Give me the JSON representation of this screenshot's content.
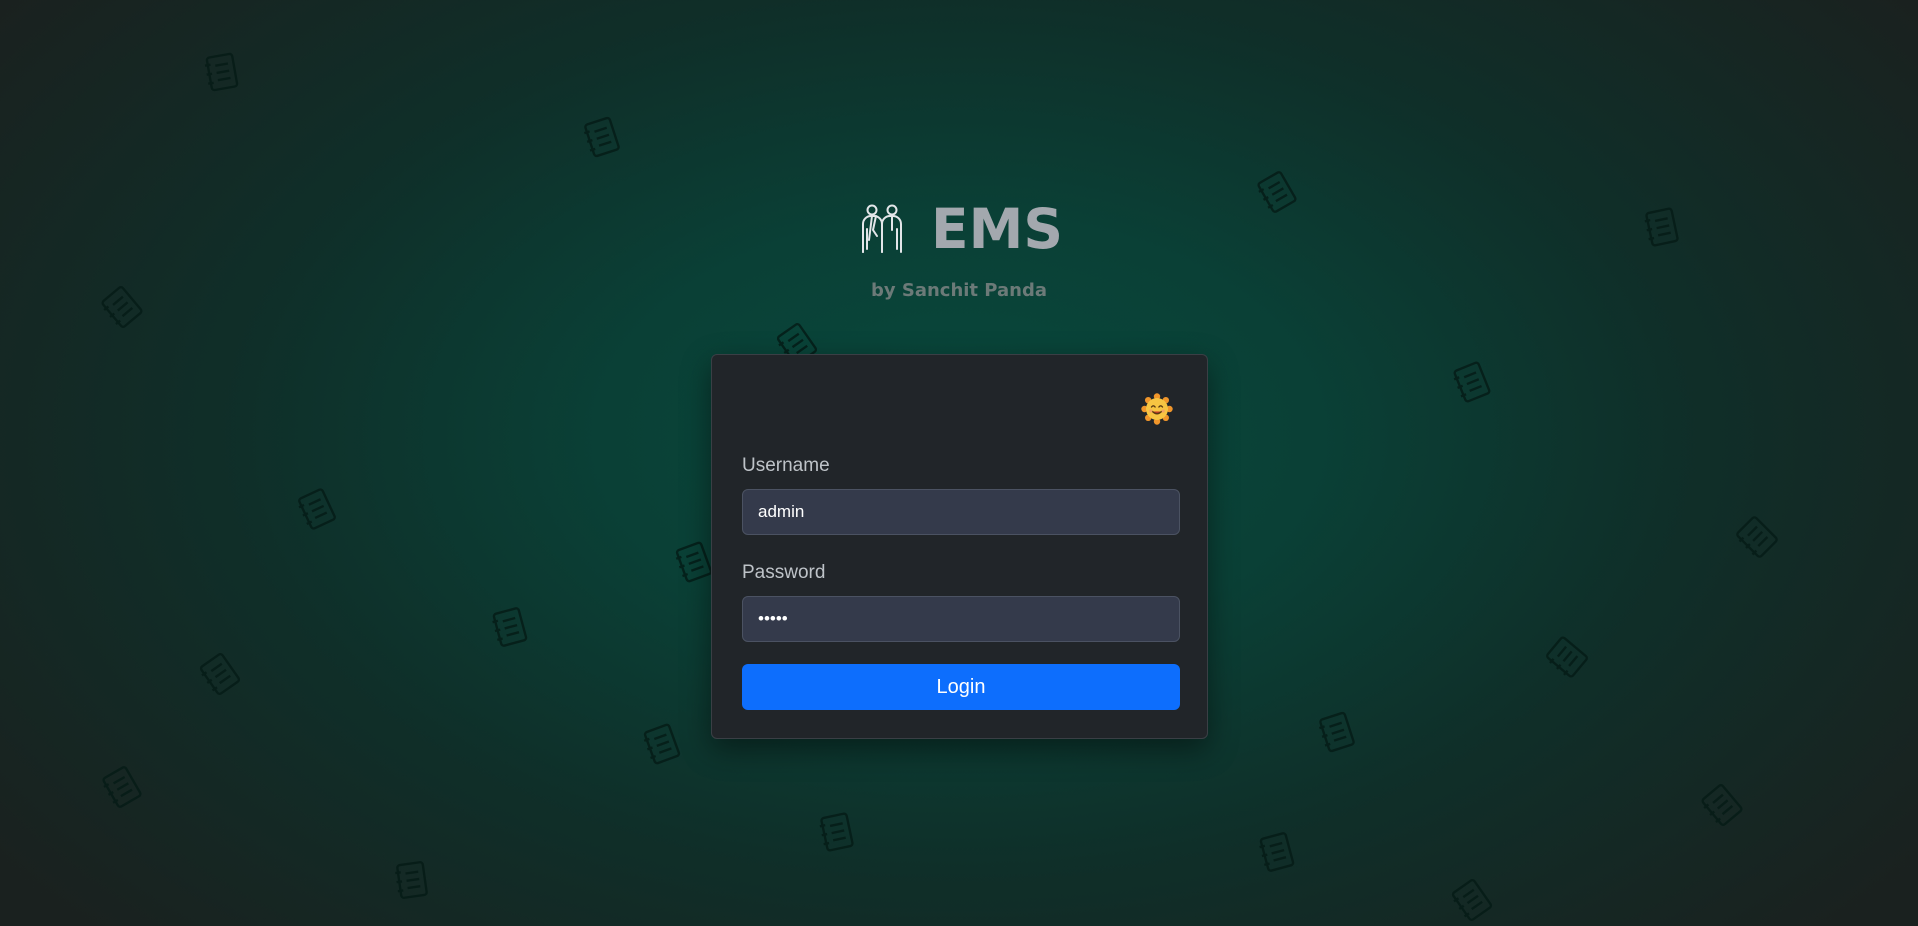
{
  "app": {
    "title": "EMS",
    "subtitle": "by Sanchit Panda",
    "logo_icon": "employees-icon",
    "background_icon": "notebook-icon"
  },
  "theme_toggle": {
    "icon": "smiling-sun-icon"
  },
  "form": {
    "username": {
      "label": "Username",
      "value": "admin"
    },
    "password": {
      "label": "Password",
      "value": "admin"
    },
    "submit_label": "Login"
  },
  "colors": {
    "accent": "#0d6efd",
    "card_bg": "#212529",
    "input_bg": "#343a4b",
    "bg_center": "#08483c",
    "bg_edge": "#1a211f"
  }
}
